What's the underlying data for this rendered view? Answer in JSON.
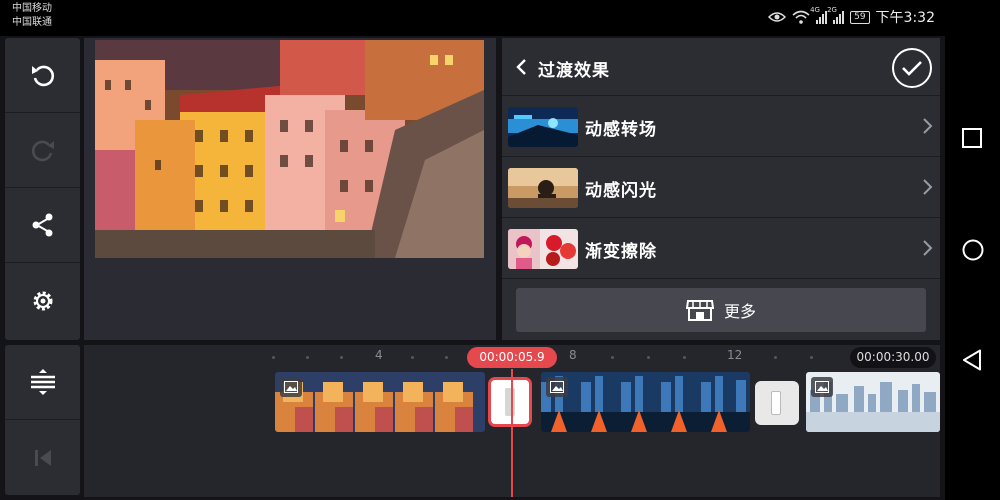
{
  "status_bar": {
    "carrier_1": "中国移动",
    "carrier_2": "中国联通",
    "net_1": "4G",
    "net_2": "2G",
    "battery": "59",
    "time": "下午3:32"
  },
  "toolbar": {
    "icons": [
      "undo-icon",
      "redo-icon",
      "share-icon",
      "settings-icon"
    ]
  },
  "panel": {
    "title": "过渡效果",
    "items": [
      {
        "label": "动感转场"
      },
      {
        "label": "动感闪光"
      },
      {
        "label": "渐变擦除"
      }
    ],
    "more_label": "更多"
  },
  "timeline": {
    "current_time": "00:00:05.9",
    "total_time": "00:00:30.00",
    "ruler_ticks": [
      "4",
      "8",
      "12"
    ]
  },
  "colors": {
    "accent": "#e5484d",
    "panel_bg": "#2c2c33",
    "app_bg": "#131318"
  }
}
